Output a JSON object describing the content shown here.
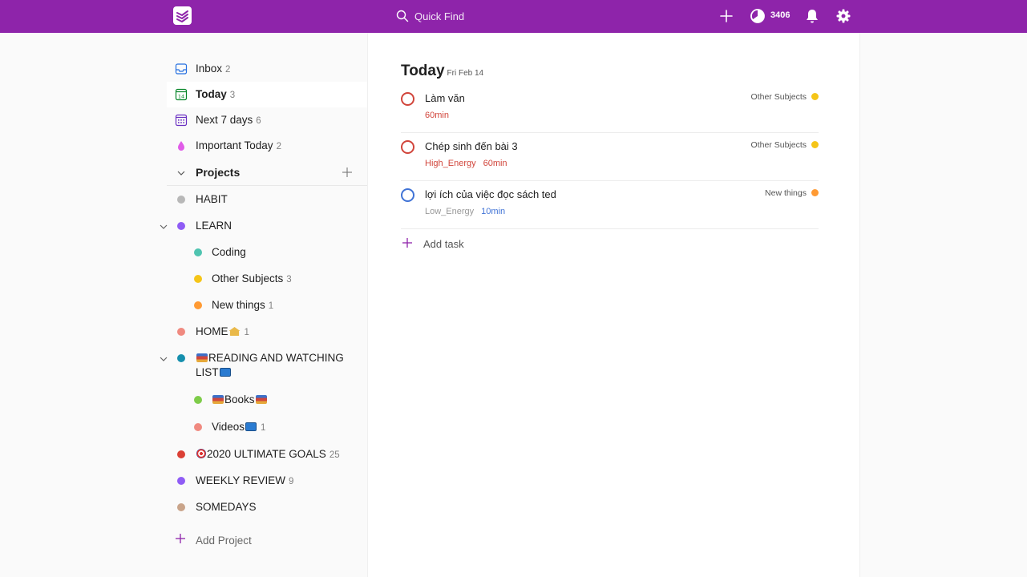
{
  "header": {
    "search_placeholder": "Quick Find",
    "karma": "3406",
    "icons": [
      "todoist-logo-icon",
      "search-icon",
      "plus-icon",
      "karma-icon",
      "bell-icon",
      "gear-icon"
    ]
  },
  "colors": {
    "brand": "#8e24aa",
    "priority_red": "#d1453b",
    "priority_blue": "#4073d6"
  },
  "sidebar": {
    "nav": [
      {
        "label": "Inbox",
        "count": "2",
        "icon": "inbox-icon"
      },
      {
        "label": "Today",
        "count": "3",
        "icon": "calendar-today-icon"
      },
      {
        "label": "Next 7 days",
        "count": "6",
        "icon": "calendar-week-icon"
      },
      {
        "label": "Important Today",
        "count": "2",
        "icon": "drop-filter-icon"
      }
    ],
    "projects_label": "Projects",
    "projects": [
      {
        "name": "HABIT",
        "count": "",
        "color": "#b8b8b8"
      },
      {
        "name": "LEARN",
        "count": "",
        "color": "#8f5cf5"
      },
      {
        "name": "Coding",
        "count": "",
        "color": "#4fc4b0"
      },
      {
        "name": "Other Subjects",
        "count": "3",
        "color": "#f5c518"
      },
      {
        "name": "New things",
        "count": "1",
        "color": "#ff9a33"
      },
      {
        "name": "HOME",
        "count": "1",
        "color": "#f08a80"
      },
      {
        "name": "READING AND WATCHING",
        "name_line2": "LIST",
        "count": "",
        "color": "#158fad"
      },
      {
        "name": "Books",
        "count": "",
        "color": "#7ecc49"
      },
      {
        "name": "Videos",
        "count": "1",
        "color": "#f08a80"
      },
      {
        "name": "2020 ULTIMATE GOALS",
        "count": "25",
        "color": "#db4035"
      },
      {
        "name": "WEEKLY REVIEW",
        "count": "9",
        "color": "#8f5cf5"
      },
      {
        "name": "SOMEDAYS",
        "count": "",
        "color": "#c9a48a"
      }
    ],
    "add_project_label": "Add Project"
  },
  "main": {
    "title": "Today",
    "date": "Fri Feb 14",
    "tasks": [
      {
        "title": "Làm văn",
        "labels": [
          {
            "text": "60min",
            "color": "#d1453b"
          }
        ],
        "project": "Other Subjects",
        "project_color": "#f5c518",
        "priority": "red"
      },
      {
        "title": "Chép sinh đến bài 3",
        "labels": [
          {
            "text": "High_Energy",
            "color": "#d1453b"
          },
          {
            "text": "60min",
            "color": "#d1453b"
          }
        ],
        "project": "Other Subjects",
        "project_color": "#f5c518",
        "priority": "red"
      },
      {
        "title": "lợi ích của việc đọc sách ted",
        "labels": [
          {
            "text": "Low_Energy",
            "color": "#999999"
          },
          {
            "text": "10min",
            "color": "#4073d6"
          }
        ],
        "project": "New things",
        "project_color": "#ff9a33",
        "priority": "blue"
      }
    ],
    "add_task_label": "Add task"
  }
}
